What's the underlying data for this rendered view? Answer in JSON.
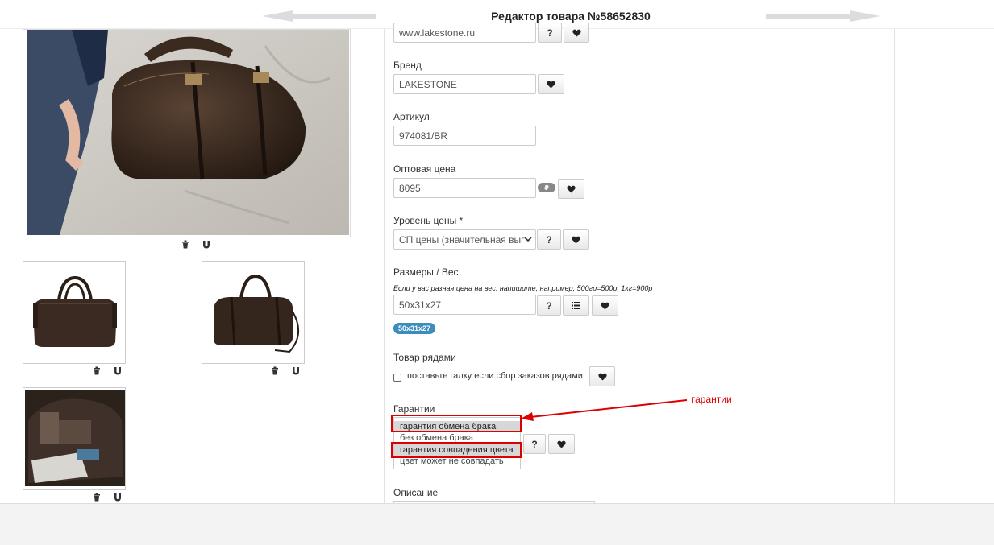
{
  "header": {
    "title": "Редактор товара №58652830"
  },
  "form": {
    "site_value": "www.lakestone.ru",
    "brand_label": "Бренд",
    "brand_value": "LAKESTONE",
    "article_label": "Артикул",
    "article_value": "974081/BR",
    "wholesale_label": "Оптовая цена",
    "wholesale_value": "8095",
    "currency_badge": "₽",
    "price_level_label": "Уровень цены *",
    "price_level_value": "СП цены (значительная выг",
    "sizes_label": "Размеры / Вес",
    "sizes_hint": "Если у вас разная цена на вес: напишите, например, 500гр=500р, 1кг=900р",
    "sizes_value": "50x31x27",
    "sizes_tag": "50x31x27",
    "rows_label": "Товар рядами",
    "rows_checkbox_label": "поставьте галку если сбор заказов рядами",
    "guarantee_label": "Гарантии",
    "guarantee_options": [
      "гарантия обмена брака",
      "без обмена брака",
      "гарантия совпадения цвета",
      "цвет может не совпадать"
    ],
    "description_label": "Описание",
    "help_label": "?"
  },
  "annotation": {
    "text": "гарантии"
  },
  "icons": [
    "trash-icon",
    "magnet-icon",
    "heart-icon",
    "list-icon",
    "arrow-left",
    "arrow-right"
  ],
  "colors": {
    "annotation_red": "#dd0000",
    "tag_blue": "#3c8dbc"
  }
}
